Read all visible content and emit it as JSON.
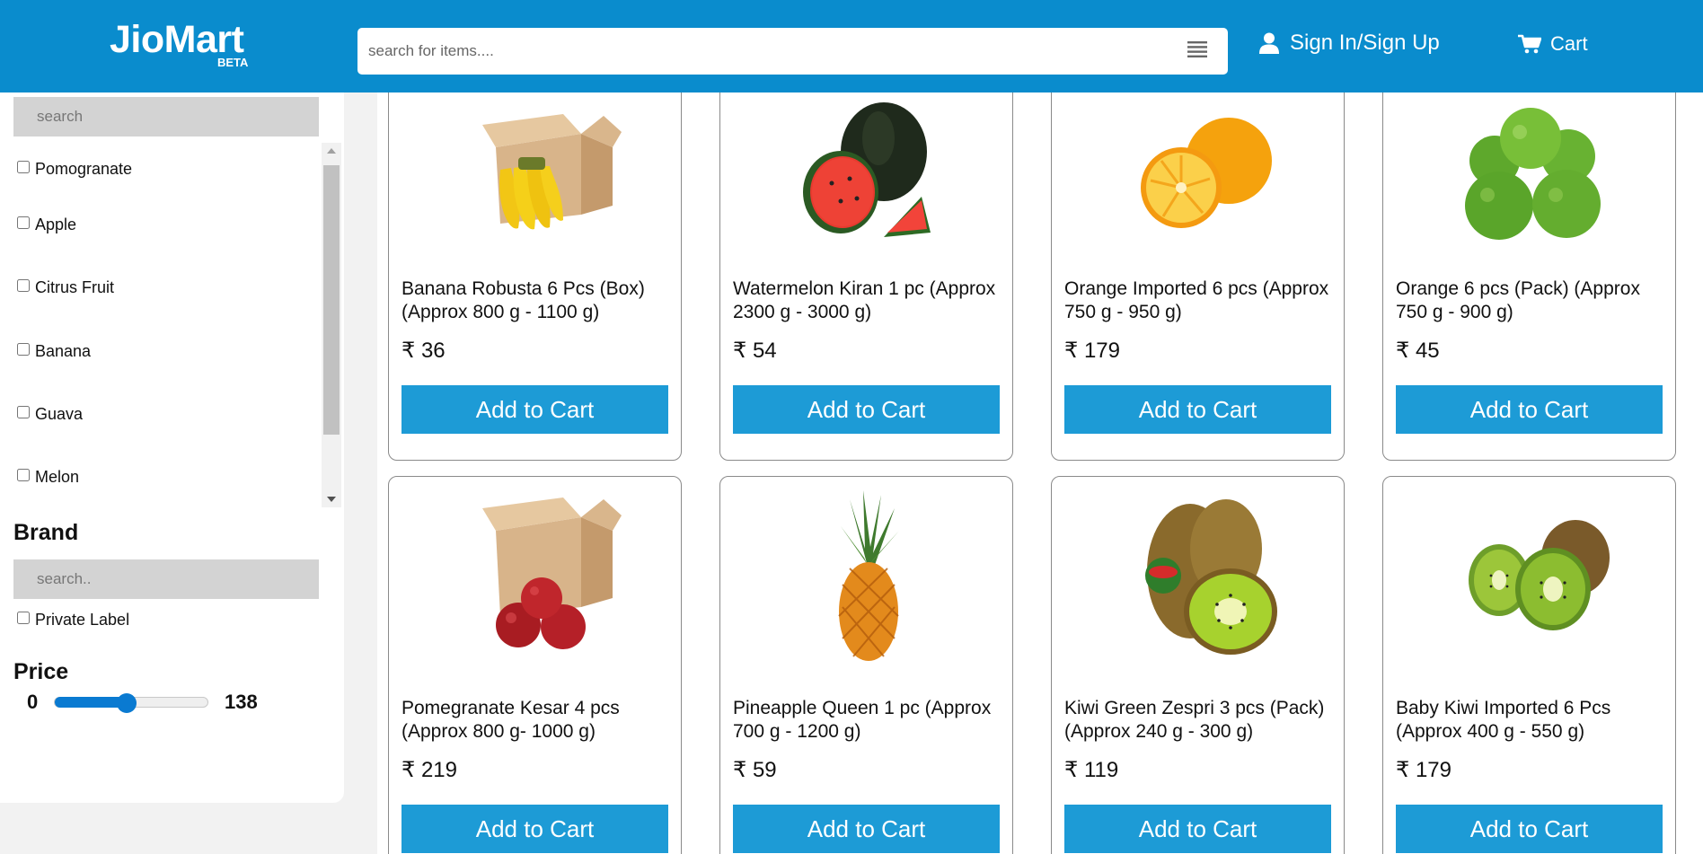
{
  "header": {
    "logo": "JioMart",
    "logo_badge": "BETA",
    "search_placeholder": "search for items....",
    "signin_label": "Sign In/Sign Up",
    "cart_label": "Cart"
  },
  "sidebar": {
    "category_search_placeholder": "search",
    "categories": [
      "Pomogranate",
      "Apple",
      "Citrus Fruit",
      "Banana",
      "Guava",
      "Melon"
    ],
    "brand_title": "Brand",
    "brand_search_placeholder": "search..",
    "brands": [
      "Private Label"
    ],
    "price_title": "Price",
    "price_min": "0",
    "price_max": "138",
    "price_slider_fraction": 0.47
  },
  "products": [
    {
      "name": "Banana Robusta 6 Pcs (Box) (Approx 800 g - 1100 g)",
      "price": "₹ 36",
      "button": "Add to Cart",
      "image": "banana-box-image"
    },
    {
      "name": "Watermelon Kiran 1 pc (Approx 2300 g - 3000 g)",
      "price": "₹ 54",
      "button": "Add to Cart",
      "image": "watermelon-image"
    },
    {
      "name": "Orange Imported 6 pcs (Approx 750 g - 950 g)",
      "price": "₹ 179",
      "button": "Add to Cart",
      "image": "orange-image"
    },
    {
      "name": "Orange 6 pcs (Pack) (Approx 750 g - 900 g)",
      "price": "₹ 45",
      "button": "Add to Cart",
      "image": "green-orange-image"
    },
    {
      "name": "Pomegranate Kesar 4 pcs (Approx 800 g- 1000 g)",
      "price": "₹ 219",
      "button": "Add to Cart",
      "image": "pomegranate-box-image"
    },
    {
      "name": "Pineapple Queen 1 pc (Approx 700 g - 1200 g)",
      "price": "₹ 59",
      "button": "Add to Cart",
      "image": "pineapple-image"
    },
    {
      "name": "Kiwi Green Zespri 3 pcs (Pack) (Approx 240 g - 300 g)",
      "price": "₹ 119",
      "button": "Add to Cart",
      "image": "kiwi-zespri-image"
    },
    {
      "name": "Baby Kiwi Imported 6 Pcs (Approx 400 g - 550 g)",
      "price": "₹ 179",
      "button": "Add to Cart",
      "image": "baby-kiwi-image"
    }
  ],
  "colors": {
    "header_bg": "#0a8ccd",
    "button_bg": "#1d9bd6",
    "slider": "#0a7ad1"
  }
}
